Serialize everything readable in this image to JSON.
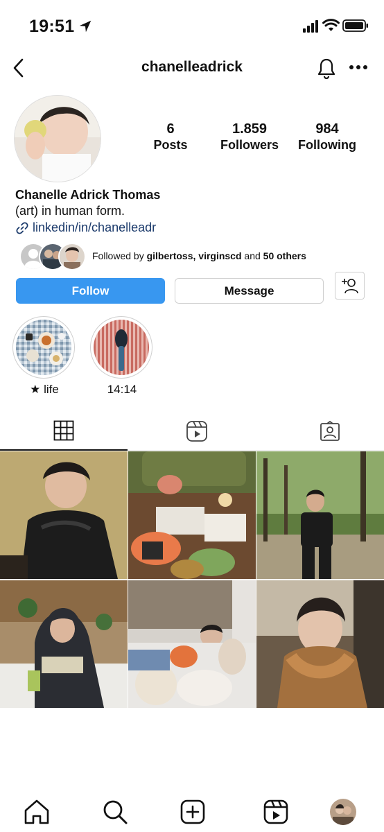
{
  "status_bar": {
    "time": "19:51"
  },
  "header": {
    "username": "chanelleadrick"
  },
  "stats": {
    "posts": {
      "value": "6",
      "label": "Posts"
    },
    "followers": {
      "value": "1.859",
      "label": "Followers"
    },
    "following": {
      "value": "984",
      "label": "Following"
    }
  },
  "bio": {
    "name": "Chanelle Adrick Thomas",
    "text": "(art) in human form.",
    "link": "linkedin/in/chanelleadr"
  },
  "followed_by": {
    "prefix": "Followed by",
    "names": "gilbertoss, virginscd",
    "middle": "and",
    "others": "50 others"
  },
  "buttons": {
    "follow": "Follow",
    "message": "Message"
  },
  "highlights": [
    {
      "label": "★ life"
    },
    {
      "label": "14:14"
    }
  ],
  "colors": {
    "accent": "#3897f0",
    "link": "#1b3a6b"
  }
}
